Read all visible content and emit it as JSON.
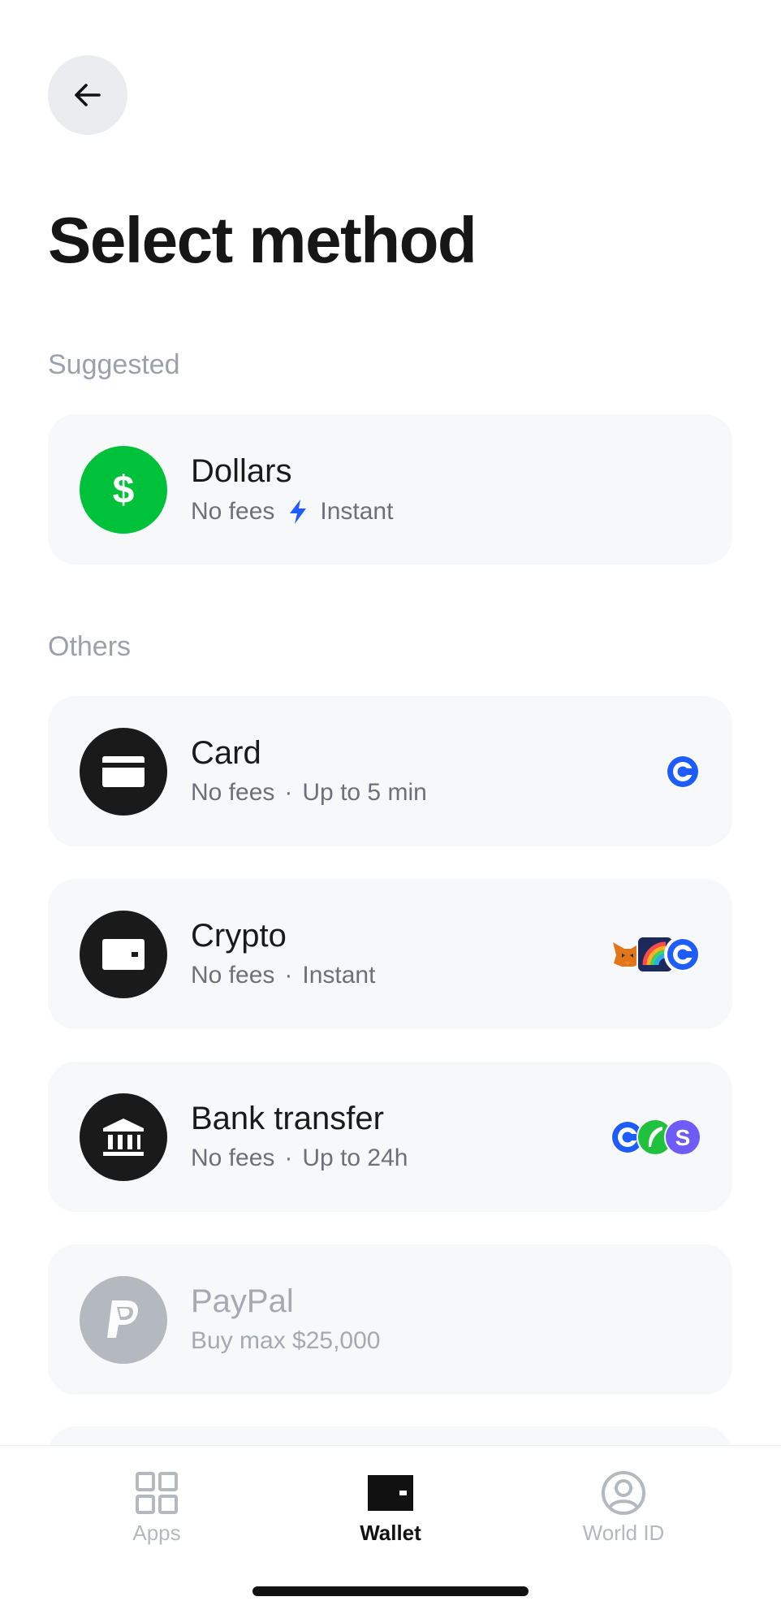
{
  "header": {
    "back_icon": "arrow-left-icon",
    "title": "Select method"
  },
  "sections": {
    "suggested_label": "Suggested",
    "others_label": "Others"
  },
  "methods": {
    "dollars": {
      "name": "Dollars",
      "sub1": "No fees",
      "sub2": "Instant",
      "icon": "dollar-icon",
      "color": "#00c13a",
      "speed_icon": "lightning-icon",
      "speed_color": "#1e5cff"
    },
    "card": {
      "name": "Card",
      "sub1": "No fees",
      "dot": "·",
      "sub2": "Up to 5 min",
      "icon": "card-icon"
    },
    "crypto": {
      "name": "Crypto",
      "sub1": "No fees",
      "dot": "·",
      "sub2": "Instant",
      "icon": "wallet-icon"
    },
    "bank": {
      "name": "Bank transfer",
      "sub1": "No fees",
      "dot": "·",
      "sub2": "Up to 24h",
      "icon": "bank-icon"
    },
    "paypal": {
      "name": "PayPal",
      "sub1": "Buy max $25,000",
      "icon": "paypal-icon",
      "disabled": true
    }
  },
  "tabbar": {
    "apps": {
      "label": "Apps",
      "icon": "grid-icon"
    },
    "wallet": {
      "label": "Wallet",
      "icon": "wallet-icon",
      "active": true
    },
    "world_id": {
      "label": "World ID",
      "icon": "user-circle-icon"
    }
  },
  "colors": {
    "accent_blue": "#1e5cff",
    "dark_circle": "#1a1a1a",
    "card_bg": "#f7f8f9",
    "muted_text": "#9ba1ab"
  }
}
